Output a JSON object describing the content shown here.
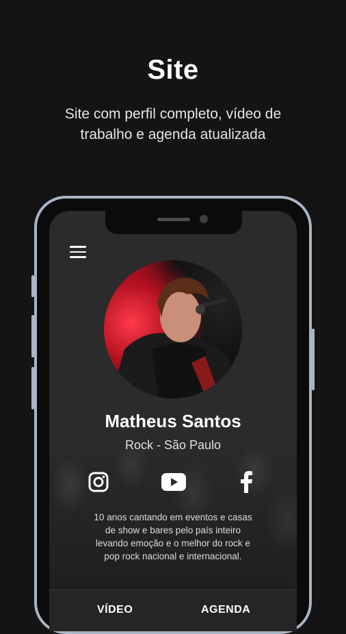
{
  "promo": {
    "title": "Site",
    "subtitle_line1": "Site com perfil completo, vídeo de",
    "subtitle_line2": "trabalho e agenda atualizada"
  },
  "profile": {
    "name": "Matheus Santos",
    "location": "Rock - São Paulo",
    "bio_lines": [
      "10 anos cantando em eventos e casas",
      "de show e bares pelo país inteiro",
      "levando emoção e o melhor do rock e",
      "pop rock nacional e internacional."
    ]
  },
  "social": [
    "instagram-icon",
    "youtube-icon",
    "facebook-icon"
  ],
  "tabs": [
    "VÍDEO",
    "AGENDA"
  ],
  "colors": {
    "background": "#141414",
    "phone_frame": "#a9b6c4",
    "screen": "#2b2b2b",
    "avatar_accent": "#b3121f"
  }
}
